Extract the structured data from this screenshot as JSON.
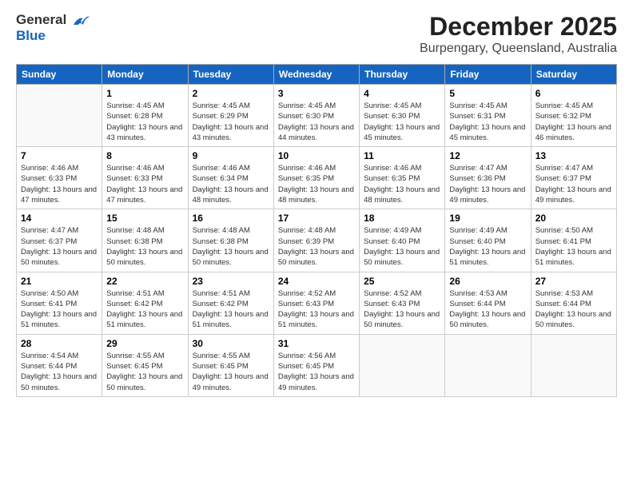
{
  "logo": {
    "line1": "General",
    "line2": "Blue"
  },
  "title": "December 2025",
  "subtitle": "Burpengary, Queensland, Australia",
  "days_of_week": [
    "Sunday",
    "Monday",
    "Tuesday",
    "Wednesday",
    "Thursday",
    "Friday",
    "Saturday"
  ],
  "weeks": [
    [
      {
        "day": "",
        "sunrise": "",
        "sunset": "",
        "daylight": ""
      },
      {
        "day": "1",
        "sunrise": "Sunrise: 4:45 AM",
        "sunset": "Sunset: 6:28 PM",
        "daylight": "Daylight: 13 hours and 43 minutes."
      },
      {
        "day": "2",
        "sunrise": "Sunrise: 4:45 AM",
        "sunset": "Sunset: 6:29 PM",
        "daylight": "Daylight: 13 hours and 43 minutes."
      },
      {
        "day": "3",
        "sunrise": "Sunrise: 4:45 AM",
        "sunset": "Sunset: 6:30 PM",
        "daylight": "Daylight: 13 hours and 44 minutes."
      },
      {
        "day": "4",
        "sunrise": "Sunrise: 4:45 AM",
        "sunset": "Sunset: 6:30 PM",
        "daylight": "Daylight: 13 hours and 45 minutes."
      },
      {
        "day": "5",
        "sunrise": "Sunrise: 4:45 AM",
        "sunset": "Sunset: 6:31 PM",
        "daylight": "Daylight: 13 hours and 45 minutes."
      },
      {
        "day": "6",
        "sunrise": "Sunrise: 4:45 AM",
        "sunset": "Sunset: 6:32 PM",
        "daylight": "Daylight: 13 hours and 46 minutes."
      }
    ],
    [
      {
        "day": "7",
        "sunrise": "Sunrise: 4:46 AM",
        "sunset": "Sunset: 6:33 PM",
        "daylight": "Daylight: 13 hours and 47 minutes."
      },
      {
        "day": "8",
        "sunrise": "Sunrise: 4:46 AM",
        "sunset": "Sunset: 6:33 PM",
        "daylight": "Daylight: 13 hours and 47 minutes."
      },
      {
        "day": "9",
        "sunrise": "Sunrise: 4:46 AM",
        "sunset": "Sunset: 6:34 PM",
        "daylight": "Daylight: 13 hours and 48 minutes."
      },
      {
        "day": "10",
        "sunrise": "Sunrise: 4:46 AM",
        "sunset": "Sunset: 6:35 PM",
        "daylight": "Daylight: 13 hours and 48 minutes."
      },
      {
        "day": "11",
        "sunrise": "Sunrise: 4:46 AM",
        "sunset": "Sunset: 6:35 PM",
        "daylight": "Daylight: 13 hours and 48 minutes."
      },
      {
        "day": "12",
        "sunrise": "Sunrise: 4:47 AM",
        "sunset": "Sunset: 6:36 PM",
        "daylight": "Daylight: 13 hours and 49 minutes."
      },
      {
        "day": "13",
        "sunrise": "Sunrise: 4:47 AM",
        "sunset": "Sunset: 6:37 PM",
        "daylight": "Daylight: 13 hours and 49 minutes."
      }
    ],
    [
      {
        "day": "14",
        "sunrise": "Sunrise: 4:47 AM",
        "sunset": "Sunset: 6:37 PM",
        "daylight": "Daylight: 13 hours and 50 minutes."
      },
      {
        "day": "15",
        "sunrise": "Sunrise: 4:48 AM",
        "sunset": "Sunset: 6:38 PM",
        "daylight": "Daylight: 13 hours and 50 minutes."
      },
      {
        "day": "16",
        "sunrise": "Sunrise: 4:48 AM",
        "sunset": "Sunset: 6:38 PM",
        "daylight": "Daylight: 13 hours and 50 minutes."
      },
      {
        "day": "17",
        "sunrise": "Sunrise: 4:48 AM",
        "sunset": "Sunset: 6:39 PM",
        "daylight": "Daylight: 13 hours and 50 minutes."
      },
      {
        "day": "18",
        "sunrise": "Sunrise: 4:49 AM",
        "sunset": "Sunset: 6:40 PM",
        "daylight": "Daylight: 13 hours and 50 minutes."
      },
      {
        "day": "19",
        "sunrise": "Sunrise: 4:49 AM",
        "sunset": "Sunset: 6:40 PM",
        "daylight": "Daylight: 13 hours and 51 minutes."
      },
      {
        "day": "20",
        "sunrise": "Sunrise: 4:50 AM",
        "sunset": "Sunset: 6:41 PM",
        "daylight": "Daylight: 13 hours and 51 minutes."
      }
    ],
    [
      {
        "day": "21",
        "sunrise": "Sunrise: 4:50 AM",
        "sunset": "Sunset: 6:41 PM",
        "daylight": "Daylight: 13 hours and 51 minutes."
      },
      {
        "day": "22",
        "sunrise": "Sunrise: 4:51 AM",
        "sunset": "Sunset: 6:42 PM",
        "daylight": "Daylight: 13 hours and 51 minutes."
      },
      {
        "day": "23",
        "sunrise": "Sunrise: 4:51 AM",
        "sunset": "Sunset: 6:42 PM",
        "daylight": "Daylight: 13 hours and 51 minutes."
      },
      {
        "day": "24",
        "sunrise": "Sunrise: 4:52 AM",
        "sunset": "Sunset: 6:43 PM",
        "daylight": "Daylight: 13 hours and 51 minutes."
      },
      {
        "day": "25",
        "sunrise": "Sunrise: 4:52 AM",
        "sunset": "Sunset: 6:43 PM",
        "daylight": "Daylight: 13 hours and 50 minutes."
      },
      {
        "day": "26",
        "sunrise": "Sunrise: 4:53 AM",
        "sunset": "Sunset: 6:44 PM",
        "daylight": "Daylight: 13 hours and 50 minutes."
      },
      {
        "day": "27",
        "sunrise": "Sunrise: 4:53 AM",
        "sunset": "Sunset: 6:44 PM",
        "daylight": "Daylight: 13 hours and 50 minutes."
      }
    ],
    [
      {
        "day": "28",
        "sunrise": "Sunrise: 4:54 AM",
        "sunset": "Sunset: 6:44 PM",
        "daylight": "Daylight: 13 hours and 50 minutes."
      },
      {
        "day": "29",
        "sunrise": "Sunrise: 4:55 AM",
        "sunset": "Sunset: 6:45 PM",
        "daylight": "Daylight: 13 hours and 50 minutes."
      },
      {
        "day": "30",
        "sunrise": "Sunrise: 4:55 AM",
        "sunset": "Sunset: 6:45 PM",
        "daylight": "Daylight: 13 hours and 49 minutes."
      },
      {
        "day": "31",
        "sunrise": "Sunrise: 4:56 AM",
        "sunset": "Sunset: 6:45 PM",
        "daylight": "Daylight: 13 hours and 49 minutes."
      },
      {
        "day": "",
        "sunrise": "",
        "sunset": "",
        "daylight": ""
      },
      {
        "day": "",
        "sunrise": "",
        "sunset": "",
        "daylight": ""
      },
      {
        "day": "",
        "sunrise": "",
        "sunset": "",
        "daylight": ""
      }
    ]
  ]
}
